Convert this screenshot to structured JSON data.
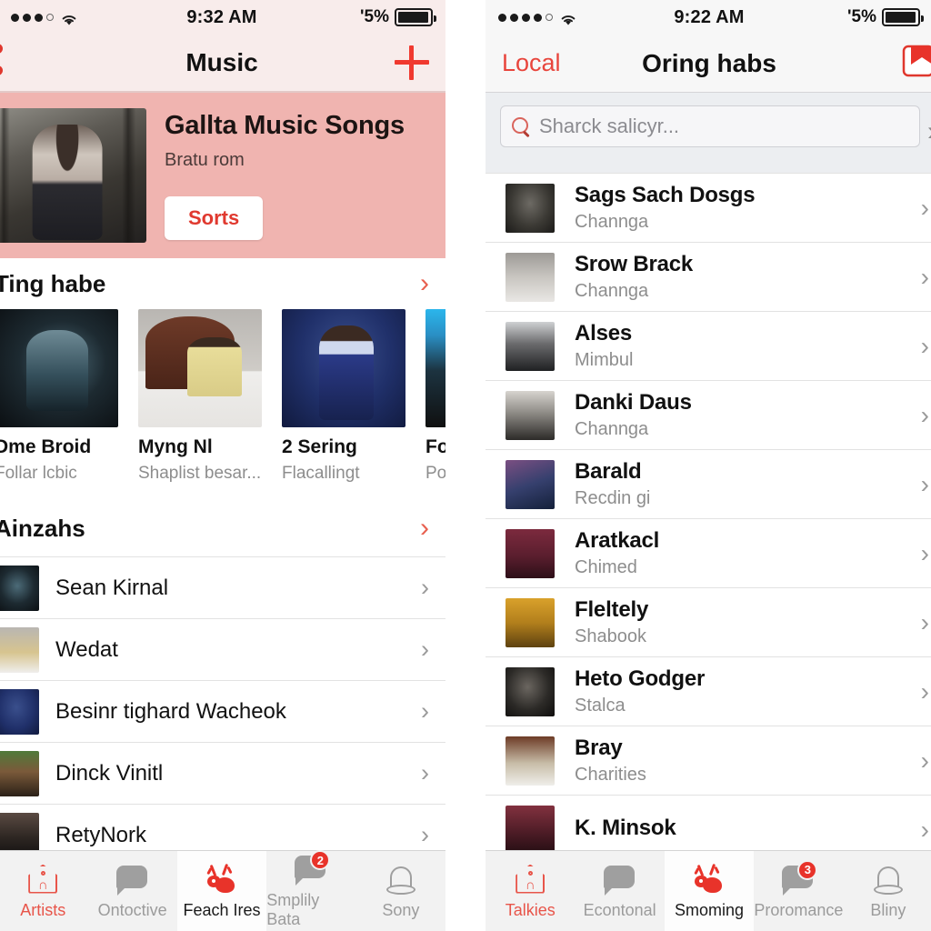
{
  "left_phone": {
    "status_bar": {
      "signal_icon": "signal-dots-icon",
      "wifi_icon": "wifi-icon",
      "time": "9:32 AM",
      "battery_text": "'5%",
      "battery_icon": "battery-icon"
    },
    "nav_bar": {
      "title": "Music",
      "add_icon": "plus-icon"
    },
    "hero": {
      "artwork_alt": "album-artwork",
      "title": "Gallta Music Songs",
      "subtitle": "Bratu rom",
      "button_label": "Sorts"
    },
    "section_featured": {
      "title": "Ting habe",
      "chevron_icon": "chevron-right-icon",
      "cards": [
        {
          "name": "Dme Broid",
          "meta": "Follar lcbic",
          "art": "t1"
        },
        {
          "name": "Myng Nl",
          "meta": "Shaplist besar...",
          "art": "t2"
        },
        {
          "name": "2 Sering",
          "meta": "Flacallingt",
          "art": "t3"
        },
        {
          "name": "Fo",
          "meta": "Po",
          "art": "t4"
        }
      ]
    },
    "section_list": {
      "title": "Ainzahs",
      "chevron_icon": "chevron-right-icon",
      "rows": [
        {
          "label": "Sean Kirnal",
          "avatar": "a11"
        },
        {
          "label": "Wedat",
          "avatar": "a12"
        },
        {
          "label": "Besinr tighard Wacheok",
          "avatar": "a13"
        },
        {
          "label": "Dinck Vinitl",
          "avatar": "a14"
        },
        {
          "label": "RetyNork",
          "avatar": "a15"
        }
      ]
    },
    "tab_bar": [
      {
        "label": "Artists",
        "icon": "house-icon",
        "state": "selected",
        "badge": ""
      },
      {
        "label": "Ontoctive",
        "icon": "speech-bubble-icon",
        "state": "normal",
        "badge": ""
      },
      {
        "label": "Feach Ires",
        "icon": "reindeer-icon",
        "state": "dark",
        "badge": ""
      },
      {
        "label": "Smplily Bata",
        "icon": "speech-bubble-icon",
        "state": "normal",
        "badge": "2"
      },
      {
        "label": "Sony",
        "icon": "bell-icon",
        "state": "normal",
        "badge": ""
      }
    ]
  },
  "right_phone": {
    "status_bar": {
      "signal_icon": "signal-dots-icon",
      "wifi_icon": "wifi-icon",
      "time": "9:22 AM",
      "battery_text": "'5%",
      "battery_icon": "battery-icon"
    },
    "nav_bar": {
      "back_label": "Local",
      "title": "Oring habs",
      "right_icon": "bookmark-icon"
    },
    "search": {
      "icon": "search-icon",
      "placeholder": "Sharck salicyr...",
      "chevron_icon": "chevron-right-icon"
    },
    "rows": [
      {
        "title": "Sags Sach Dosgs",
        "subtitle": "Channga",
        "avatar": "a1"
      },
      {
        "title": "Srow Brack",
        "subtitle": "Channga",
        "avatar": "a2"
      },
      {
        "title": "Alses",
        "subtitle": "Mimbul",
        "avatar": "a3"
      },
      {
        "title": "Danki Daus",
        "subtitle": "Channga",
        "avatar": "a4"
      },
      {
        "title": "Barald",
        "subtitle": "Recdin gi",
        "avatar": "a5"
      },
      {
        "title": "Aratkacl",
        "subtitle": "Chimed",
        "avatar": "a6"
      },
      {
        "title": "Fleltely",
        "subtitle": "Shabook",
        "avatar": "a7"
      },
      {
        "title": "Heto Godger",
        "subtitle": "Stalca",
        "avatar": "a8"
      },
      {
        "title": "Bray",
        "subtitle": "Charities",
        "avatar": "a9"
      },
      {
        "title": "K. Minsok",
        "subtitle": "",
        "avatar": "a10"
      }
    ],
    "tab_bar": [
      {
        "label": "Talkies",
        "icon": "house-icon",
        "state": "selected",
        "badge": ""
      },
      {
        "label": "Econtonal",
        "icon": "speech-bubble-icon",
        "state": "normal",
        "badge": ""
      },
      {
        "label": "Smoming",
        "icon": "reindeer-icon",
        "state": "dark",
        "badge": ""
      },
      {
        "label": "Proromance",
        "icon": "speech-bubble-icon",
        "state": "normal",
        "badge": "3"
      },
      {
        "label": "Bliny",
        "icon": "bell-icon",
        "state": "normal",
        "badge": ""
      }
    ]
  },
  "colors": {
    "accent_red": "#e8453c",
    "hero_pink": "#f0b4b0",
    "nav_pink": "#f8eceb",
    "badge_red": "#e8332a",
    "muted_gray": "#8d8d8d"
  }
}
